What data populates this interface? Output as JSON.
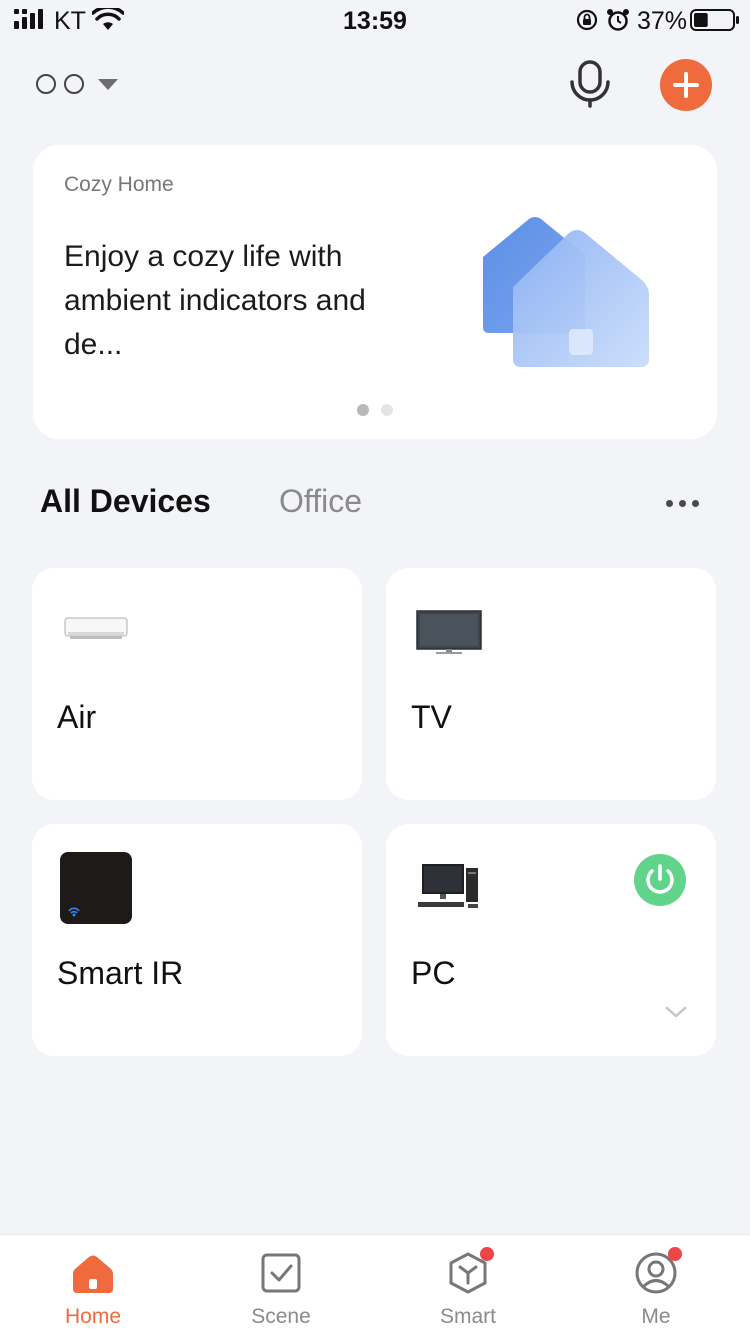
{
  "status_bar": {
    "carrier": "KT",
    "time": "13:59",
    "battery_percent": "37%",
    "battery_level": 0.37,
    "icons": [
      "signal-icon",
      "wifi-icon",
      "rotation-lock-icon",
      "alarm-icon",
      "battery-icon"
    ]
  },
  "header": {
    "home_selector_icon": "chevron-down-icon",
    "mic_icon": "microphone-icon",
    "add_icon": "plus-icon",
    "accent_color": "#ef6b3e"
  },
  "banner": {
    "subtitle": "Cozy Home",
    "title": "Enjoy a cozy life with ambient indicators and de...",
    "page_count": 2,
    "active_page": 1
  },
  "tabs": [
    {
      "label": "All Devices",
      "active": true
    },
    {
      "label": "Office",
      "active": false
    }
  ],
  "more_icon": "more-dots-icon",
  "devices": [
    {
      "name": "Air",
      "icon": "air-conditioner-icon"
    },
    {
      "name": "TV",
      "icon": "tv-icon"
    },
    {
      "name": "Smart IR",
      "icon": "smart-ir-hub-icon"
    },
    {
      "name": "PC",
      "icon": "pc-icon",
      "power_on": true,
      "power_color": "#62d38a"
    }
  ],
  "tabbar": [
    {
      "label": "Home",
      "icon": "home-icon",
      "active": true
    },
    {
      "label": "Scene",
      "icon": "scene-checkbox-icon",
      "active": false
    },
    {
      "label": "Smart",
      "icon": "smart-cube-icon",
      "active": false,
      "badge": true
    },
    {
      "label": "Me",
      "icon": "user-icon",
      "active": false,
      "badge": true
    }
  ]
}
